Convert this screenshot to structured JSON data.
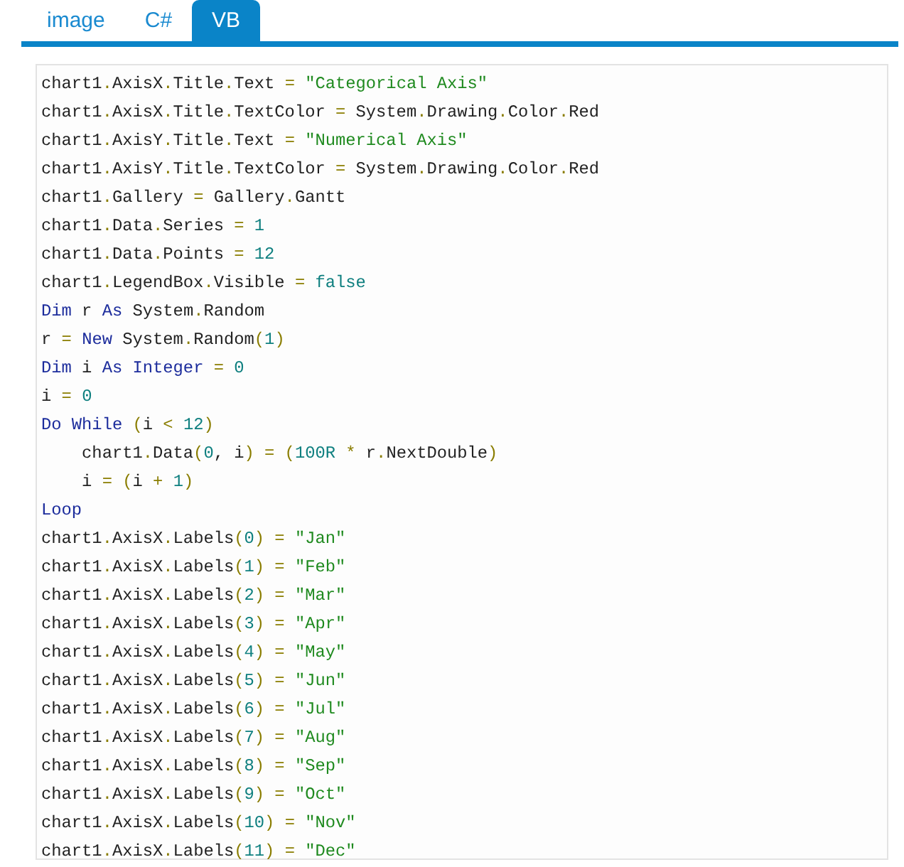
{
  "tabs": [
    {
      "label": "image",
      "selected": false
    },
    {
      "label": "C#",
      "selected": false
    },
    {
      "label": "VB",
      "selected": true
    }
  ],
  "code_lines": [
    {
      "tokens": [
        {
          "kind": "id",
          "text": "chart1"
        },
        {
          "kind": "op",
          "text": "."
        },
        {
          "kind": "id",
          "text": "AxisX"
        },
        {
          "kind": "op",
          "text": "."
        },
        {
          "kind": "id",
          "text": "Title"
        },
        {
          "kind": "op",
          "text": "."
        },
        {
          "kind": "id",
          "text": "Text "
        },
        {
          "kind": "op",
          "text": "= "
        },
        {
          "kind": "str",
          "text": "\"Categorical Axis\""
        }
      ]
    },
    {
      "tokens": [
        {
          "kind": "id",
          "text": "chart1"
        },
        {
          "kind": "op",
          "text": "."
        },
        {
          "kind": "id",
          "text": "AxisX"
        },
        {
          "kind": "op",
          "text": "."
        },
        {
          "kind": "id",
          "text": "Title"
        },
        {
          "kind": "op",
          "text": "."
        },
        {
          "kind": "id",
          "text": "TextColor "
        },
        {
          "kind": "op",
          "text": "="
        },
        {
          "kind": "id",
          "text": " System"
        },
        {
          "kind": "op",
          "text": "."
        },
        {
          "kind": "id",
          "text": "Drawing"
        },
        {
          "kind": "op",
          "text": "."
        },
        {
          "kind": "id",
          "text": "Color"
        },
        {
          "kind": "op",
          "text": "."
        },
        {
          "kind": "id",
          "text": "Red"
        }
      ]
    },
    {
      "tokens": [
        {
          "kind": "id",
          "text": "chart1"
        },
        {
          "kind": "op",
          "text": "."
        },
        {
          "kind": "id",
          "text": "AxisY"
        },
        {
          "kind": "op",
          "text": "."
        },
        {
          "kind": "id",
          "text": "Title"
        },
        {
          "kind": "op",
          "text": "."
        },
        {
          "kind": "id",
          "text": "Text "
        },
        {
          "kind": "op",
          "text": "= "
        },
        {
          "kind": "str",
          "text": "\"Numerical Axis\""
        }
      ]
    },
    {
      "tokens": [
        {
          "kind": "id",
          "text": "chart1"
        },
        {
          "kind": "op",
          "text": "."
        },
        {
          "kind": "id",
          "text": "AxisY"
        },
        {
          "kind": "op",
          "text": "."
        },
        {
          "kind": "id",
          "text": "Title"
        },
        {
          "kind": "op",
          "text": "."
        },
        {
          "kind": "id",
          "text": "TextColor "
        },
        {
          "kind": "op",
          "text": "="
        },
        {
          "kind": "id",
          "text": " System"
        },
        {
          "kind": "op",
          "text": "."
        },
        {
          "kind": "id",
          "text": "Drawing"
        },
        {
          "kind": "op",
          "text": "."
        },
        {
          "kind": "id",
          "text": "Color"
        },
        {
          "kind": "op",
          "text": "."
        },
        {
          "kind": "id",
          "text": "Red"
        }
      ]
    },
    {
      "tokens": [
        {
          "kind": "id",
          "text": "chart1"
        },
        {
          "kind": "op",
          "text": "."
        },
        {
          "kind": "id",
          "text": "Gallery "
        },
        {
          "kind": "op",
          "text": "="
        },
        {
          "kind": "id",
          "text": " Gallery"
        },
        {
          "kind": "op",
          "text": "."
        },
        {
          "kind": "id",
          "text": "Gantt"
        }
      ]
    },
    {
      "tokens": [
        {
          "kind": "id",
          "text": "chart1"
        },
        {
          "kind": "op",
          "text": "."
        },
        {
          "kind": "id",
          "text": "Data"
        },
        {
          "kind": "op",
          "text": "."
        },
        {
          "kind": "id",
          "text": "Series "
        },
        {
          "kind": "op",
          "text": "= "
        },
        {
          "kind": "num",
          "text": "1"
        }
      ]
    },
    {
      "tokens": [
        {
          "kind": "id",
          "text": "chart1"
        },
        {
          "kind": "op",
          "text": "."
        },
        {
          "kind": "id",
          "text": "Data"
        },
        {
          "kind": "op",
          "text": "."
        },
        {
          "kind": "id",
          "text": "Points "
        },
        {
          "kind": "op",
          "text": "= "
        },
        {
          "kind": "num",
          "text": "12"
        }
      ]
    },
    {
      "tokens": [
        {
          "kind": "id",
          "text": "chart1"
        },
        {
          "kind": "op",
          "text": "."
        },
        {
          "kind": "id",
          "text": "LegendBox"
        },
        {
          "kind": "op",
          "text": "."
        },
        {
          "kind": "id",
          "text": "Visible "
        },
        {
          "kind": "op",
          "text": "= "
        },
        {
          "kind": "num",
          "text": "false"
        }
      ]
    },
    {
      "tokens": [
        {
          "kind": "kw",
          "text": "Dim"
        },
        {
          "kind": "id",
          "text": " r "
        },
        {
          "kind": "kw",
          "text": "As"
        },
        {
          "kind": "id",
          "text": " System"
        },
        {
          "kind": "op",
          "text": "."
        },
        {
          "kind": "id",
          "text": "Random"
        }
      ]
    },
    {
      "tokens": [
        {
          "kind": "id",
          "text": "r "
        },
        {
          "kind": "op",
          "text": "= "
        },
        {
          "kind": "kw",
          "text": "New"
        },
        {
          "kind": "id",
          "text": " System"
        },
        {
          "kind": "op",
          "text": "."
        },
        {
          "kind": "id",
          "text": "Random"
        },
        {
          "kind": "op",
          "text": "("
        },
        {
          "kind": "num",
          "text": "1"
        },
        {
          "kind": "op",
          "text": ")"
        }
      ]
    },
    {
      "tokens": [
        {
          "kind": "kw",
          "text": "Dim"
        },
        {
          "kind": "id",
          "text": " i "
        },
        {
          "kind": "kw",
          "text": "As Integer"
        },
        {
          "kind": "op",
          "text": " = "
        },
        {
          "kind": "num",
          "text": "0"
        }
      ]
    },
    {
      "tokens": [
        {
          "kind": "id",
          "text": "i "
        },
        {
          "kind": "op",
          "text": "= "
        },
        {
          "kind": "num",
          "text": "0"
        }
      ]
    },
    {
      "tokens": [
        {
          "kind": "kw",
          "text": "Do While"
        },
        {
          "kind": "op",
          "text": " ("
        },
        {
          "kind": "id",
          "text": "i "
        },
        {
          "kind": "op",
          "text": "< "
        },
        {
          "kind": "num",
          "text": "12"
        },
        {
          "kind": "op",
          "text": ")"
        }
      ]
    },
    {
      "tokens": [
        {
          "kind": "id",
          "text": "    chart1"
        },
        {
          "kind": "op",
          "text": "."
        },
        {
          "kind": "id",
          "text": "Data"
        },
        {
          "kind": "op",
          "text": "("
        },
        {
          "kind": "num",
          "text": "0"
        },
        {
          "kind": "id",
          "text": ", i"
        },
        {
          "kind": "op",
          "text": ") = ("
        },
        {
          "kind": "num",
          "text": "100R"
        },
        {
          "kind": "op",
          "text": " *"
        },
        {
          "kind": "id",
          "text": " r"
        },
        {
          "kind": "op",
          "text": "."
        },
        {
          "kind": "id",
          "text": "NextDouble"
        },
        {
          "kind": "op",
          "text": ")"
        }
      ]
    },
    {
      "tokens": [
        {
          "kind": "id",
          "text": "    i "
        },
        {
          "kind": "op",
          "text": "= ("
        },
        {
          "kind": "id",
          "text": "i "
        },
        {
          "kind": "op",
          "text": "+ "
        },
        {
          "kind": "num",
          "text": "1"
        },
        {
          "kind": "op",
          "text": ")"
        }
      ]
    },
    {
      "tokens": [
        {
          "kind": "kw",
          "text": "Loop"
        }
      ]
    },
    {
      "tokens": [
        {
          "kind": "id",
          "text": "chart1"
        },
        {
          "kind": "op",
          "text": "."
        },
        {
          "kind": "id",
          "text": "AxisX"
        },
        {
          "kind": "op",
          "text": "."
        },
        {
          "kind": "id",
          "text": "Labels"
        },
        {
          "kind": "op",
          "text": "("
        },
        {
          "kind": "num",
          "text": "0"
        },
        {
          "kind": "op",
          "text": ") = "
        },
        {
          "kind": "str",
          "text": "\"Jan\""
        }
      ]
    },
    {
      "tokens": [
        {
          "kind": "id",
          "text": "chart1"
        },
        {
          "kind": "op",
          "text": "."
        },
        {
          "kind": "id",
          "text": "AxisX"
        },
        {
          "kind": "op",
          "text": "."
        },
        {
          "kind": "id",
          "text": "Labels"
        },
        {
          "kind": "op",
          "text": "("
        },
        {
          "kind": "num",
          "text": "1"
        },
        {
          "kind": "op",
          "text": ") = "
        },
        {
          "kind": "str",
          "text": "\"Feb\""
        }
      ]
    },
    {
      "tokens": [
        {
          "kind": "id",
          "text": "chart1"
        },
        {
          "kind": "op",
          "text": "."
        },
        {
          "kind": "id",
          "text": "AxisX"
        },
        {
          "kind": "op",
          "text": "."
        },
        {
          "kind": "id",
          "text": "Labels"
        },
        {
          "kind": "op",
          "text": "("
        },
        {
          "kind": "num",
          "text": "2"
        },
        {
          "kind": "op",
          "text": ") = "
        },
        {
          "kind": "str",
          "text": "\"Mar\""
        }
      ]
    },
    {
      "tokens": [
        {
          "kind": "id",
          "text": "chart1"
        },
        {
          "kind": "op",
          "text": "."
        },
        {
          "kind": "id",
          "text": "AxisX"
        },
        {
          "kind": "op",
          "text": "."
        },
        {
          "kind": "id",
          "text": "Labels"
        },
        {
          "kind": "op",
          "text": "("
        },
        {
          "kind": "num",
          "text": "3"
        },
        {
          "kind": "op",
          "text": ") = "
        },
        {
          "kind": "str",
          "text": "\"Apr\""
        }
      ]
    },
    {
      "tokens": [
        {
          "kind": "id",
          "text": "chart1"
        },
        {
          "kind": "op",
          "text": "."
        },
        {
          "kind": "id",
          "text": "AxisX"
        },
        {
          "kind": "op",
          "text": "."
        },
        {
          "kind": "id",
          "text": "Labels"
        },
        {
          "kind": "op",
          "text": "("
        },
        {
          "kind": "num",
          "text": "4"
        },
        {
          "kind": "op",
          "text": ") = "
        },
        {
          "kind": "str",
          "text": "\"May\""
        }
      ]
    },
    {
      "tokens": [
        {
          "kind": "id",
          "text": "chart1"
        },
        {
          "kind": "op",
          "text": "."
        },
        {
          "kind": "id",
          "text": "AxisX"
        },
        {
          "kind": "op",
          "text": "."
        },
        {
          "kind": "id",
          "text": "Labels"
        },
        {
          "kind": "op",
          "text": "("
        },
        {
          "kind": "num",
          "text": "5"
        },
        {
          "kind": "op",
          "text": ") = "
        },
        {
          "kind": "str",
          "text": "\"Jun\""
        }
      ]
    },
    {
      "tokens": [
        {
          "kind": "id",
          "text": "chart1"
        },
        {
          "kind": "op",
          "text": "."
        },
        {
          "kind": "id",
          "text": "AxisX"
        },
        {
          "kind": "op",
          "text": "."
        },
        {
          "kind": "id",
          "text": "Labels"
        },
        {
          "kind": "op",
          "text": "("
        },
        {
          "kind": "num",
          "text": "6"
        },
        {
          "kind": "op",
          "text": ") = "
        },
        {
          "kind": "str",
          "text": "\"Jul\""
        }
      ]
    },
    {
      "tokens": [
        {
          "kind": "id",
          "text": "chart1"
        },
        {
          "kind": "op",
          "text": "."
        },
        {
          "kind": "id",
          "text": "AxisX"
        },
        {
          "kind": "op",
          "text": "."
        },
        {
          "kind": "id",
          "text": "Labels"
        },
        {
          "kind": "op",
          "text": "("
        },
        {
          "kind": "num",
          "text": "7"
        },
        {
          "kind": "op",
          "text": ") = "
        },
        {
          "kind": "str",
          "text": "\"Aug\""
        }
      ]
    },
    {
      "tokens": [
        {
          "kind": "id",
          "text": "chart1"
        },
        {
          "kind": "op",
          "text": "."
        },
        {
          "kind": "id",
          "text": "AxisX"
        },
        {
          "kind": "op",
          "text": "."
        },
        {
          "kind": "id",
          "text": "Labels"
        },
        {
          "kind": "op",
          "text": "("
        },
        {
          "kind": "num",
          "text": "8"
        },
        {
          "kind": "op",
          "text": ") = "
        },
        {
          "kind": "str",
          "text": "\"Sep\""
        }
      ]
    },
    {
      "tokens": [
        {
          "kind": "id",
          "text": "chart1"
        },
        {
          "kind": "op",
          "text": "."
        },
        {
          "kind": "id",
          "text": "AxisX"
        },
        {
          "kind": "op",
          "text": "."
        },
        {
          "kind": "id",
          "text": "Labels"
        },
        {
          "kind": "op",
          "text": "("
        },
        {
          "kind": "num",
          "text": "9"
        },
        {
          "kind": "op",
          "text": ") = "
        },
        {
          "kind": "str",
          "text": "\"Oct\""
        }
      ]
    },
    {
      "tokens": [
        {
          "kind": "id",
          "text": "chart1"
        },
        {
          "kind": "op",
          "text": "."
        },
        {
          "kind": "id",
          "text": "AxisX"
        },
        {
          "kind": "op",
          "text": "."
        },
        {
          "kind": "id",
          "text": "Labels"
        },
        {
          "kind": "op",
          "text": "("
        },
        {
          "kind": "num",
          "text": "10"
        },
        {
          "kind": "op",
          "text": ") = "
        },
        {
          "kind": "str",
          "text": "\"Nov\""
        }
      ]
    },
    {
      "tokens": [
        {
          "kind": "id",
          "text": "chart1"
        },
        {
          "kind": "op",
          "text": "."
        },
        {
          "kind": "id",
          "text": "AxisX"
        },
        {
          "kind": "op",
          "text": "."
        },
        {
          "kind": "id",
          "text": "Labels"
        },
        {
          "kind": "op",
          "text": "("
        },
        {
          "kind": "num",
          "text": "11"
        },
        {
          "kind": "op",
          "text": ") = "
        },
        {
          "kind": "str",
          "text": "\"Dec\""
        }
      ]
    }
  ]
}
